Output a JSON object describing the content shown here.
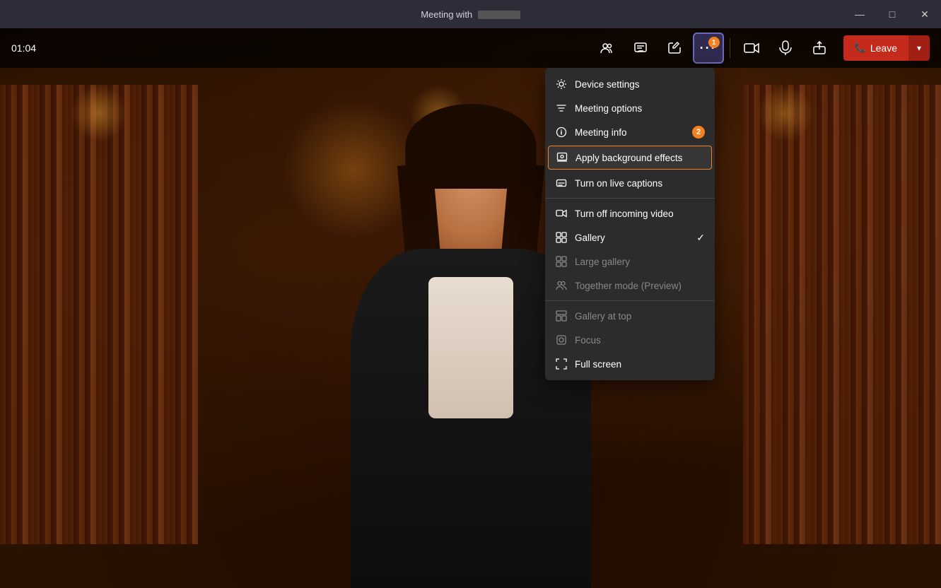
{
  "titleBar": {
    "title": "Meeting with",
    "titleBlurred": "████",
    "minimize": "—",
    "restore": "□",
    "close": "✕"
  },
  "toolbar": {
    "timer": "01:04",
    "buttons": [
      {
        "name": "people",
        "icon": "👥",
        "badge": null
      },
      {
        "name": "chat",
        "icon": "💬",
        "badge": null
      },
      {
        "name": "reactions",
        "icon": "✋",
        "badge": null
      },
      {
        "name": "more",
        "icon": "•••",
        "badge": "1"
      },
      {
        "name": "camera",
        "icon": "🎥",
        "badge": null
      },
      {
        "name": "mic",
        "icon": "🎤",
        "badge": null
      },
      {
        "name": "share",
        "icon": "⬆",
        "badge": null
      }
    ],
    "leaveButton": "Leave"
  },
  "contextMenu": {
    "items": [
      {
        "id": "device-settings",
        "label": "Device settings",
        "icon": "⚙",
        "badge": null,
        "disabled": false,
        "check": false,
        "highlighted": false
      },
      {
        "id": "meeting-options",
        "label": "Meeting options",
        "icon": "⚙",
        "badge": null,
        "disabled": false,
        "check": false,
        "highlighted": false
      },
      {
        "id": "meeting-info",
        "label": "Meeting info",
        "icon": "ℹ",
        "badge": "2",
        "disabled": false,
        "check": false,
        "highlighted": false
      },
      {
        "id": "apply-bg",
        "label": "Apply background effects",
        "icon": "✦",
        "badge": null,
        "disabled": false,
        "check": false,
        "highlighted": true
      },
      {
        "id": "live-captions",
        "label": "Turn on live captions",
        "icon": "⊡",
        "badge": null,
        "disabled": false,
        "check": false,
        "highlighted": false
      },
      {
        "id": "divider1",
        "type": "divider"
      },
      {
        "id": "incoming-video",
        "label": "Turn off incoming video",
        "icon": "⬛",
        "badge": null,
        "disabled": false,
        "check": false,
        "highlighted": false
      },
      {
        "id": "gallery",
        "label": "Gallery",
        "icon": "⊞",
        "badge": null,
        "disabled": false,
        "check": true,
        "highlighted": false
      },
      {
        "id": "large-gallery",
        "label": "Large gallery",
        "icon": "⊞",
        "badge": null,
        "disabled": true,
        "check": false,
        "highlighted": false
      },
      {
        "id": "together-mode",
        "label": "Together mode (Preview)",
        "icon": "👥",
        "badge": null,
        "disabled": true,
        "check": false,
        "highlighted": false
      },
      {
        "id": "divider2",
        "type": "divider"
      },
      {
        "id": "gallery-top",
        "label": "Gallery at top",
        "icon": "⬜",
        "badge": null,
        "disabled": true,
        "check": false,
        "highlighted": false
      },
      {
        "id": "focus",
        "label": "Focus",
        "icon": "⊟",
        "badge": null,
        "disabled": true,
        "check": false,
        "highlighted": false
      },
      {
        "id": "full-screen",
        "label": "Full screen",
        "icon": "⬜",
        "badge": null,
        "disabled": false,
        "check": false,
        "highlighted": false
      }
    ]
  }
}
